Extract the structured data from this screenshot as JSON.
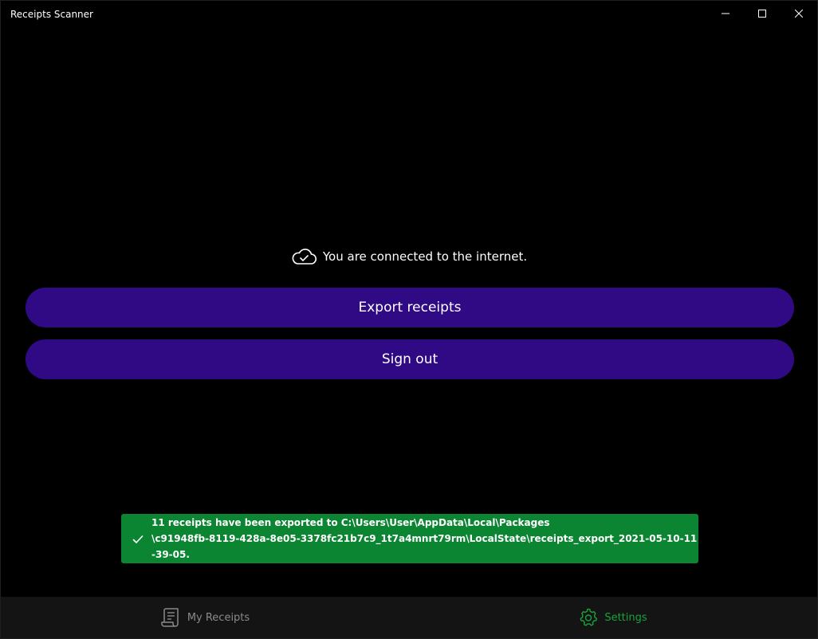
{
  "window": {
    "title": "Receipts Scanner"
  },
  "status": {
    "text": "You are connected to the internet.",
    "icon": "cloud-check-icon"
  },
  "actions": {
    "export_label": "Export receipts",
    "signout_label": "Sign out"
  },
  "toast": {
    "line1": "11 receipts have been exported to C:\\Users\\User\\AppData\\Local\\Packages",
    "line2": "\\c91948fb-8119-428a-8e05-3378fc21b7c9_1t7a4mnrt79rm\\LocalState\\receipts_export_2021-05-10-11-39-05.",
    "icon": "checkmark-icon"
  },
  "nav": {
    "items": [
      {
        "label": "My Receipts",
        "icon": "receipt-icon",
        "active": false
      },
      {
        "label": "Settings",
        "icon": "gear-icon",
        "active": true
      }
    ]
  },
  "colors": {
    "button_bg": "#300a85",
    "toast_bg": "#0c8533",
    "nav_active": "#18a33c",
    "nav_inactive": "#8a8a8a"
  }
}
